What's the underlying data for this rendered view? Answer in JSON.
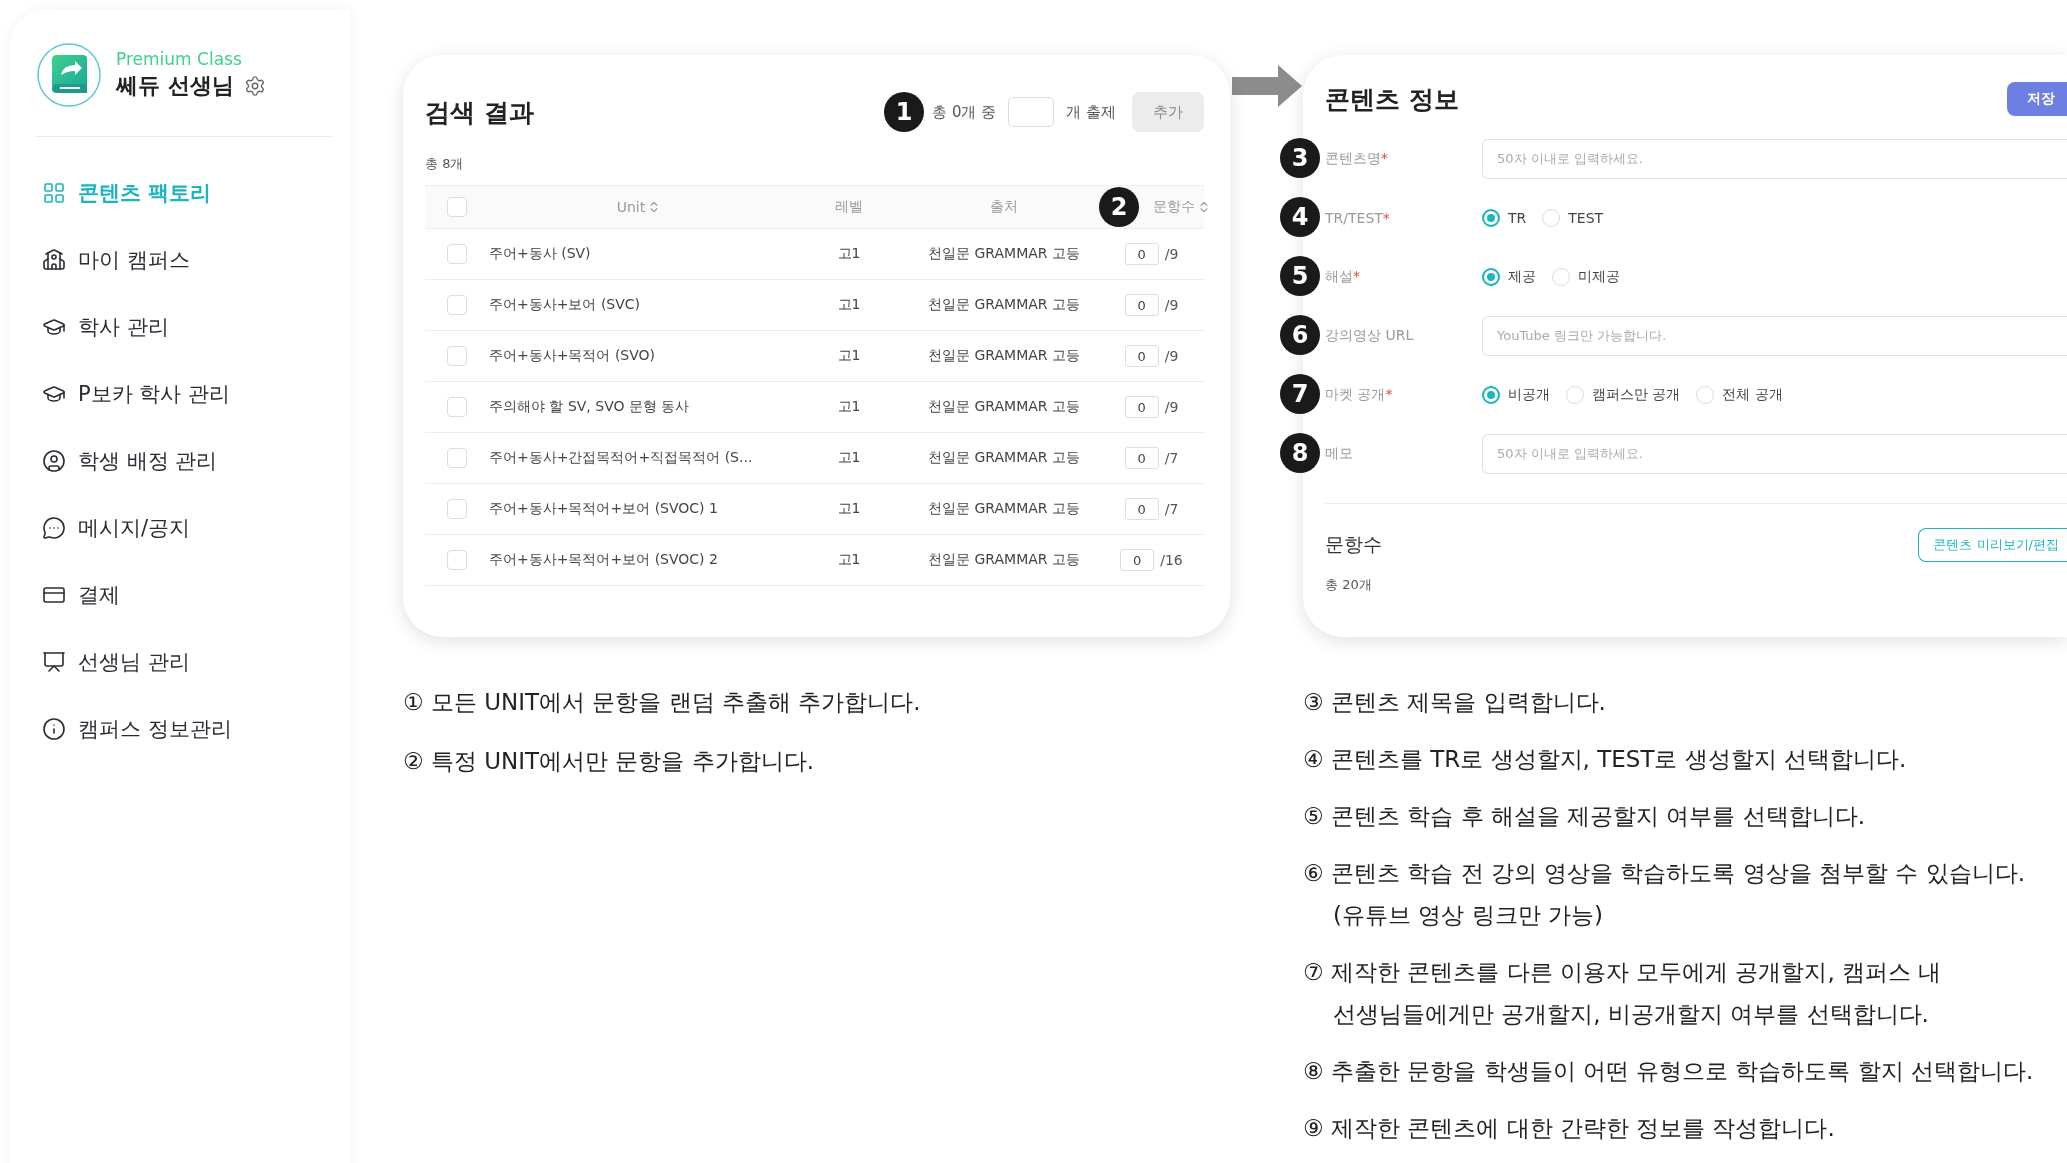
{
  "sidebar": {
    "profile": {
      "badge": "Premium Class",
      "name": "쎄듀 선생님"
    },
    "items": [
      {
        "label": "콘텐츠 팩토리",
        "selected": true
      },
      {
        "label": "마이 캠퍼스",
        "selected": false
      },
      {
        "label": "학사 관리",
        "selected": false
      },
      {
        "label": "P보카 학사 관리",
        "selected": false
      },
      {
        "label": "학생 배정 관리",
        "selected": false
      },
      {
        "label": "메시지/공지",
        "selected": false
      },
      {
        "label": "결제",
        "selected": false
      },
      {
        "label": "선생님 관리",
        "selected": false
      },
      {
        "label": "캠퍼스 정보관리",
        "selected": false
      }
    ]
  },
  "search_panel": {
    "title": "검색 결과",
    "marker": "1",
    "summary_prefix": "총 0개 중",
    "summary_suffix": "개 출제",
    "add_button": {
      "label": "추가",
      "disabled": true
    },
    "total": "총 8개",
    "header_marker": "2",
    "header_checked": false,
    "columns": [
      {
        "label": "Unit",
        "sortable": true
      },
      {
        "label": "레벨",
        "sortable": false
      },
      {
        "label": "출처",
        "sortable": false
      },
      {
        "label": "문항수",
        "sortable": true
      }
    ],
    "rows": [
      {
        "checked": false,
        "unit": "주어+동사 (SV)",
        "level": "고1",
        "source": "천일문 GRAMMAR 고등",
        "count": "0",
        "max": "/9"
      },
      {
        "checked": false,
        "unit": "주어+동사+보어 (SVC)",
        "level": "고1",
        "source": "천일문 GRAMMAR 고등",
        "count": "0",
        "max": "/9"
      },
      {
        "checked": false,
        "unit": "주어+동사+목적어 (SVO)",
        "level": "고1",
        "source": "천일문 GRAMMAR 고등",
        "count": "0",
        "max": "/9"
      },
      {
        "checked": false,
        "unit": "주의해야 할 SV, SVO 문형 동사",
        "level": "고1",
        "source": "천일문 GRAMMAR 고등",
        "count": "0",
        "max": "/9"
      },
      {
        "checked": false,
        "unit": "주어+동사+간접목적어+직접목적어 (S...",
        "level": "고1",
        "source": "천일문 GRAMMAR 고등",
        "count": "0",
        "max": "/7"
      },
      {
        "checked": false,
        "unit": "주어+동사+목적어+보어 (SVOC) 1",
        "level": "고1",
        "source": "천일문 GRAMMAR 고등",
        "count": "0",
        "max": "/7"
      },
      {
        "checked": false,
        "unit": "주어+동사+목적어+보어 (SVOC) 2",
        "level": "고1",
        "source": "천일문 GRAMMAR 고등",
        "count": "0",
        "max": "/16"
      }
    ]
  },
  "content_panel": {
    "title": "콘텐츠 정보",
    "save_button": "저장",
    "fields": [
      {
        "kind": "text",
        "marker": "3",
        "label": "콘텐츠명",
        "required_mark": "*",
        "placeholder": "50자 이내로 입력하세요."
      },
      {
        "kind": "radio",
        "marker": "4",
        "label": "TR/TEST",
        "required_mark": "*",
        "options": [
          {
            "label": "TR",
            "selected": true
          },
          {
            "label": "TEST",
            "selected": false
          }
        ]
      },
      {
        "kind": "radio",
        "marker": "5",
        "label": "해설",
        "required_mark": "*",
        "options": [
          {
            "label": "제공",
            "selected": true
          },
          {
            "label": "미제공",
            "selected": false
          }
        ]
      },
      {
        "kind": "text",
        "marker": "6",
        "label": "강의영상 URL",
        "placeholder": "YouTube 링크만 가능합니다."
      },
      {
        "kind": "radio",
        "marker": "7",
        "label": "마켓 공개",
        "required_mark": "*",
        "options": [
          {
            "label": "비공개",
            "selected": true
          },
          {
            "label": "캠퍼스만 공개",
            "selected": false
          },
          {
            "label": "전체 공개",
            "selected": false
          }
        ]
      },
      {
        "kind": "text",
        "marker": "8",
        "label": "메모",
        "placeholder": "50자 이내로 입력하세요."
      }
    ],
    "section": {
      "title": "문항수",
      "button": "콘텐츠 미리보기/편집",
      "total": "총 20개"
    }
  },
  "notes_left": [
    {
      "lines": [
        "① 모든 UNIT에서 문항을 랜덤 추출해 추가합니다."
      ]
    },
    {
      "lines": [
        "② 특정 UNIT에서만 문항을 추가합니다."
      ]
    }
  ],
  "notes_right": [
    {
      "lines": [
        "③ 콘텐츠 제목을 입력합니다."
      ]
    },
    {
      "lines": [
        "④ 콘텐츠를 TR로 생성할지, TEST로 생성할지 선택합니다."
      ]
    },
    {
      "lines": [
        "⑤ 콘텐츠 학습 후 해설을 제공할지 여부를 선택합니다."
      ]
    },
    {
      "lines": [
        "⑥ 콘텐츠 학습 전 강의 영상을 학습하도록 영상을 첨부할 수 있습니다.",
        "(유튜브 영상 링크만 가능)"
      ]
    },
    {
      "lines": [
        "⑦ 제작한 콘텐츠를 다른 이용자 모두에게 공개할지, 캠퍼스 내",
        "선생님들에게만 공개할지, 비공개할지 여부를 선택합니다."
      ]
    },
    {
      "lines": [
        "⑧ 추출한 문항을 학생들이 어떤 유형으로 학습하도록 할지 선택합니다."
      ]
    },
    {
      "lines": [
        "⑨ 제작한 콘텐츠에 대한 간략한 정보를 작성합니다."
      ]
    }
  ]
}
